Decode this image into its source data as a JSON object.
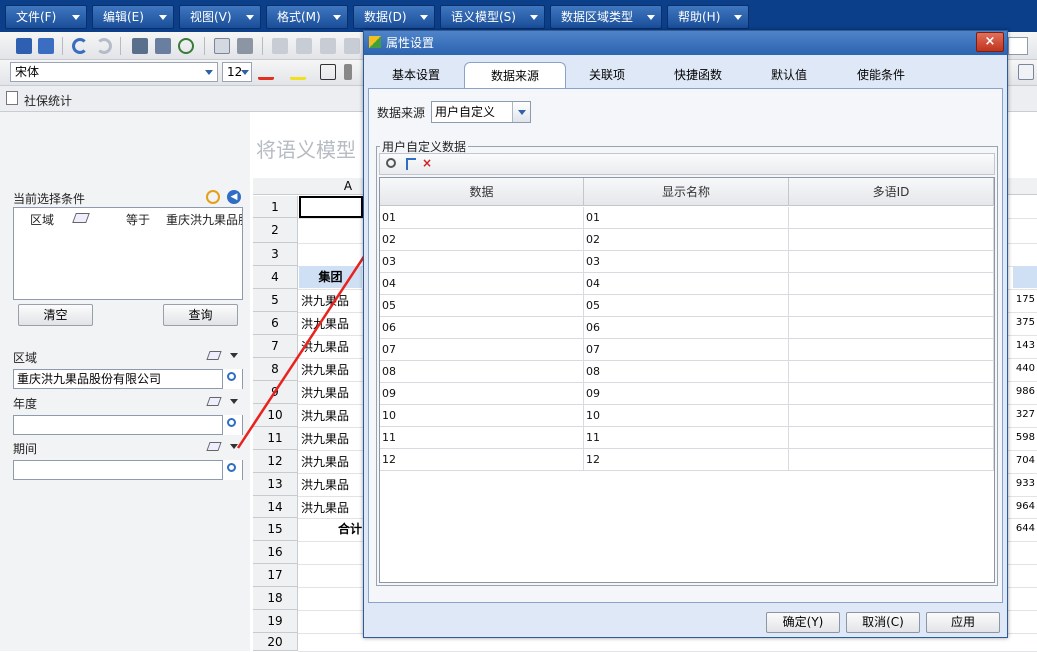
{
  "menu": {
    "items": [
      {
        "label": "文件(F)"
      },
      {
        "label": "编辑(E)"
      },
      {
        "label": "视图(V)"
      },
      {
        "label": "格式(M)"
      },
      {
        "label": "数据(D)"
      },
      {
        "label": "语义模型(S)"
      },
      {
        "label": "数据区域类型"
      },
      {
        "label": "帮助(H)"
      }
    ]
  },
  "toolbar2": {
    "font_name": "宋体",
    "font_size": "12"
  },
  "doc_tab": {
    "label": "社保统计"
  },
  "left_panel": {
    "current_conditions_label": "当前选择条件",
    "condition": {
      "field": "区域",
      "operator": "等于",
      "value": "重庆洪九果品股"
    },
    "clear_button": "清空",
    "query_button": "查询",
    "region_label": "区域",
    "region_value": "重庆洪九果品股份有限公司",
    "year_label": "年度",
    "year_value": "",
    "period_label": "期间",
    "period_value": ""
  },
  "sheet": {
    "watermark": "将语义模型",
    "column_a": "A",
    "rows": [
      "1",
      "2",
      "3",
      "4",
      "5",
      "6",
      "7",
      "8",
      "9",
      "10",
      "11",
      "12",
      "13",
      "14",
      "15",
      "16",
      "17",
      "18",
      "19",
      "20"
    ],
    "header_cell": "集团",
    "company_cells": [
      "洪九果品",
      "洪九果品",
      "洪九果品",
      "洪九果品",
      "洪九果品",
      "洪九果品",
      "洪九果品",
      "洪九果品",
      "洪九果品",
      "洪九果品"
    ],
    "total_label": "合计",
    "right_values": [
      "175",
      "375",
      "143",
      "440",
      "986",
      "327",
      "598",
      "704",
      "933",
      "964",
      "644"
    ]
  },
  "dialog": {
    "title": "属性设置",
    "close": "×",
    "tabs": [
      {
        "label": "基本设置"
      },
      {
        "label": "数据来源"
      },
      {
        "label": "关联项"
      },
      {
        "label": "快捷函数"
      },
      {
        "label": "默认值"
      },
      {
        "label": "使能条件"
      }
    ],
    "source_label": "数据来源",
    "source_value": "用户自定义",
    "group_label": "用户自定义数据",
    "columns": [
      "数据",
      "显示名称",
      "多语ID"
    ],
    "rows": [
      {
        "data": "01",
        "display": "01",
        "id": ""
      },
      {
        "data": "02",
        "display": "02",
        "id": ""
      },
      {
        "data": "03",
        "display": "03",
        "id": ""
      },
      {
        "data": "04",
        "display": "04",
        "id": ""
      },
      {
        "data": "05",
        "display": "05",
        "id": ""
      },
      {
        "data": "06",
        "display": "06",
        "id": ""
      },
      {
        "data": "07",
        "display": "07",
        "id": ""
      },
      {
        "data": "08",
        "display": "08",
        "id": ""
      },
      {
        "data": "09",
        "display": "09",
        "id": ""
      },
      {
        "data": "10",
        "display": "10",
        "id": ""
      },
      {
        "data": "11",
        "display": "11",
        "id": ""
      },
      {
        "data": "12",
        "display": "12",
        "id": ""
      }
    ],
    "ok_button": "确定(Y)",
    "cancel_button": "取消(C)",
    "apply_button": "应用"
  },
  "colors": {
    "menubar": "#0b3f8a",
    "annotation_arrow": "#e8231f",
    "dialog_title": "#2c63b0"
  }
}
